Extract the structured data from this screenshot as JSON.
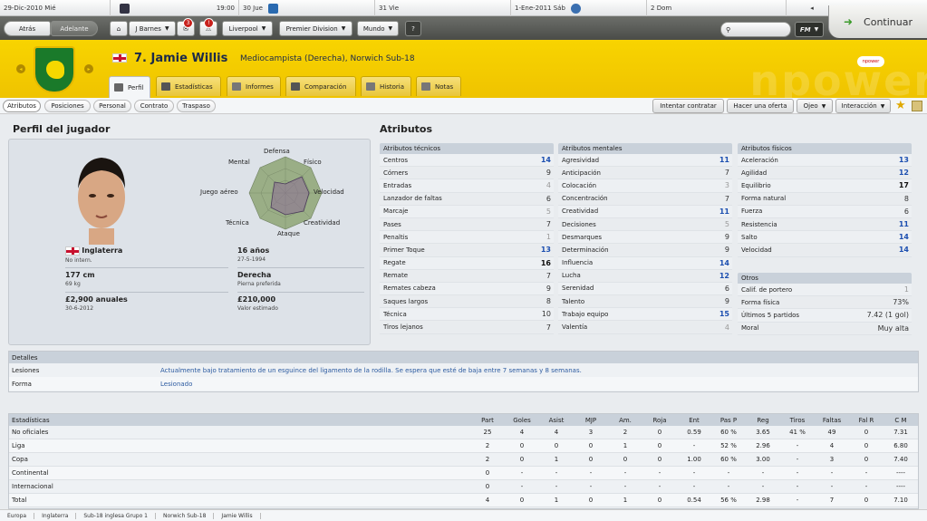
{
  "topbar": [
    {
      "date": "29-Dic-2010",
      "day": "Mié",
      "time": "19:00"
    },
    {
      "date": "30",
      "day": "Jue"
    },
    {
      "date": "31",
      "day": "Vie"
    },
    {
      "date": "1-Ene-2011",
      "day": "Sáb"
    },
    {
      "date": "2",
      "day": "Dom"
    }
  ],
  "nav": {
    "back": "Atrás",
    "forward": "Adelante",
    "manager": "J Barnes",
    "badge1": "3",
    "badge2": "!",
    "club": "Liverpool",
    "league": "Premier Division",
    "world": "Mundo",
    "help": "?",
    "fm": "FM",
    "continue": "Continuar"
  },
  "player": {
    "title": "7. Jamie Willis",
    "role": "Mediocampista (Derecha), Norwich Sub-18",
    "sponsor": "npower"
  },
  "tabs": [
    "Perfil",
    "Estadísticas",
    "Informes",
    "Comparación",
    "Historia",
    "Notas"
  ],
  "subtabs": [
    "Atributos",
    "Posiciones",
    "Personal",
    "Contrato",
    "Traspaso"
  ],
  "actions": {
    "contratar": "Intentar contratar",
    "oferta": "Hacer una oferta",
    "ojeo": "Ojeo",
    "interaccion": "Interacción"
  },
  "profile": {
    "heading": "Perfil del jugador",
    "radar_labels": [
      "Defensa",
      "Físico",
      "Velocidad",
      "Creatividad",
      "Ataque",
      "Técnica",
      "Juego aéreo",
      "Mental"
    ],
    "nation": "Inglaterra",
    "caps": "No intern.",
    "age": "16 años",
    "dob": "27-5-1994",
    "height": "177 cm",
    "weight": "69 kg",
    "foot": "Derecha",
    "foot_label": "Pierna preferida",
    "wage": "£2,900 anuales",
    "contract": "30-6-2012",
    "value": "£210,000",
    "value_label": "Valor estimado"
  },
  "attributes": {
    "heading": "Atributos",
    "tecnicos": {
      "title": "Atributos técnicos",
      "rows": [
        [
          "Centros",
          "14"
        ],
        [
          "Córners",
          "9"
        ],
        [
          "Entradas",
          "4"
        ],
        [
          "Lanzador de faltas",
          "6"
        ],
        [
          "Marcaje",
          "5"
        ],
        [
          "Pases",
          "7"
        ],
        [
          "Penaltis",
          "1"
        ],
        [
          "Primer Toque",
          "13"
        ],
        [
          "Regate",
          "16"
        ],
        [
          "Remate",
          "7"
        ],
        [
          "Remates cabeza",
          "9"
        ],
        [
          "Saques largos",
          "8"
        ],
        [
          "Técnica",
          "10"
        ],
        [
          "Tiros lejanos",
          "7"
        ]
      ]
    },
    "mentales": {
      "title": "Atributos mentales",
      "rows": [
        [
          "Agresividad",
          "11"
        ],
        [
          "Anticipación",
          "7"
        ],
        [
          "Colocación",
          "3"
        ],
        [
          "Concentración",
          "7"
        ],
        [
          "Creatividad",
          "11"
        ],
        [
          "Decisiones",
          "5"
        ],
        [
          "Desmarques",
          "9"
        ],
        [
          "Determinación",
          "9"
        ],
        [
          "Influencia",
          "14"
        ],
        [
          "Lucha",
          "12"
        ],
        [
          "Serenidad",
          "6"
        ],
        [
          "Talento",
          "9"
        ],
        [
          "Trabajo equipo",
          "15"
        ],
        [
          "Valentía",
          "4"
        ]
      ]
    },
    "fisicos": {
      "title": "Atributos físicos",
      "rows": [
        [
          "Aceleración",
          "13"
        ],
        [
          "Agilidad",
          "12"
        ],
        [
          "Equilibrio",
          "17"
        ],
        [
          "Forma natural",
          "8"
        ],
        [
          "Fuerza",
          "6"
        ],
        [
          "Resistencia",
          "11"
        ],
        [
          "Salto",
          "14"
        ],
        [
          "Velocidad",
          "14"
        ]
      ]
    },
    "otros": {
      "title": "Otros",
      "rows": [
        [
          "Calif. de portero",
          "1"
        ],
        [
          "Forma física",
          "73%"
        ],
        [
          "Últimos 5 partidos",
          "7.42 (1 gol)"
        ],
        [
          "Moral",
          "Muy alta"
        ]
      ]
    }
  },
  "details": {
    "title": "Detalles",
    "lesiones_label": "Lesiones",
    "lesiones": "Actualmente bajo tratamiento de un esguince del ligamento de la rodilla. Se espera que esté de baja entre 7 semanas y 8 semanas.",
    "forma_label": "Forma",
    "forma": "Lesionado"
  },
  "stats": {
    "title": "Estadísticas",
    "headers": [
      "Part",
      "Goles",
      "Asist",
      "MJP",
      "Am.",
      "Roja",
      "Ent",
      "Pas P",
      "Reg",
      "Tiros",
      "Faltas",
      "Fal R",
      "C M"
    ],
    "rows": [
      {
        "name": "No oficiales",
        "cells": [
          "25",
          "4",
          "4",
          "3",
          "2",
          "0",
          "0.59",
          "60 %",
          "3.65",
          "41 %",
          "49",
          "0",
          "7.31"
        ]
      },
      {
        "name": "Liga",
        "cells": [
          "2",
          "0",
          "0",
          "0",
          "1",
          "0",
          "-",
          "52 %",
          "2.96",
          "-",
          "4",
          "0",
          "6.80"
        ]
      },
      {
        "name": "Copa",
        "cells": [
          "2",
          "0",
          "1",
          "0",
          "0",
          "0",
          "1.00",
          "60 %",
          "3.00",
          "-",
          "3",
          "0",
          "7.40"
        ]
      },
      {
        "name": "Continental",
        "cells": [
          "0",
          "-",
          "-",
          "-",
          "-",
          "-",
          "-",
          "-",
          "-",
          "-",
          "-",
          "-",
          "----"
        ]
      },
      {
        "name": "Internacional",
        "cells": [
          "0",
          "-",
          "-",
          "-",
          "-",
          "-",
          "-",
          "-",
          "-",
          "-",
          "-",
          "-",
          "----"
        ]
      },
      {
        "name": "Total",
        "cells": [
          "4",
          "0",
          "1",
          "0",
          "1",
          "0",
          "0.54",
          "56 %",
          "2.98",
          "-",
          "7",
          "0",
          "7.10"
        ]
      }
    ]
  },
  "breadcrumbs": [
    "Europa",
    "Inglaterra",
    "Sub-18 inglesa Grupo 1",
    "Norwich Sub-18",
    "Jamie Willis"
  ],
  "colors": {
    "header": "#f2c800",
    "highlight": "#1c4fb0",
    "panel": "#dde2e8"
  }
}
